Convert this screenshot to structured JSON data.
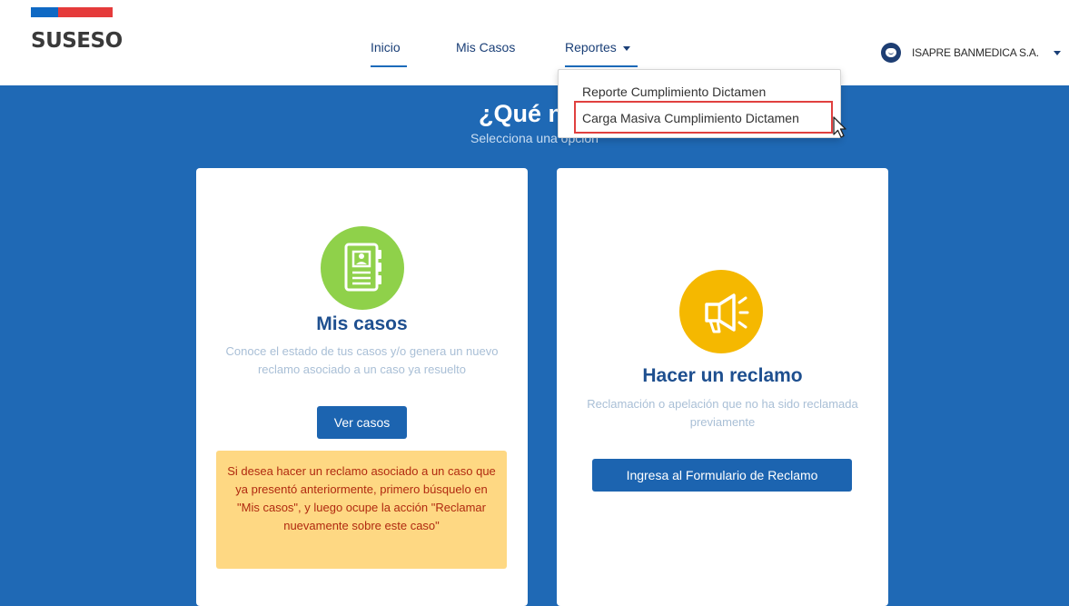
{
  "header": {
    "logo": "SUSESO",
    "colors": {
      "flag_blue": "#0f69c4",
      "flag_red": "#e53b3b"
    }
  },
  "nav": {
    "items": [
      {
        "label": "Inicio",
        "active": true
      },
      {
        "label": "Mis Casos",
        "active": false
      },
      {
        "label": "Reportes",
        "active": false,
        "open": true
      }
    ]
  },
  "user": {
    "icon": "user-face-icon",
    "name": "ISAPRE BANMEDICA S.A."
  },
  "dropdown": {
    "items": [
      {
        "label": "Reporte Cumplimiento Dictamen"
      },
      {
        "label": "Carga Masiva Cumplimiento Dictamen",
        "highlighted": true
      }
    ]
  },
  "main": {
    "title": "¿Qué nec",
    "subtitle": "Selecciona una opción",
    "background": "#1f69b5"
  },
  "cards": {
    "mis_casos": {
      "icon": "folder-document-icon",
      "title": "Mis casos",
      "description": "Conoce el estado de tus casos y/o genera un nuevo reclamo asociado a un caso ya resuelto",
      "button": "Ver casos",
      "notice": "Si desea hacer un reclamo asociado a un caso que ya presentó anteriormente, primero búsquelo en \"Mis casos\", y luego ocupe la acción \"Reclamar nuevamente sobre este caso\""
    },
    "reclamo": {
      "icon": "megaphone-icon",
      "title": "Hacer un reclamo",
      "description": "Reclamación o apelación que no ha sido reclamada previamente",
      "button": "Ingresa al Formulario de Reclamo"
    }
  }
}
